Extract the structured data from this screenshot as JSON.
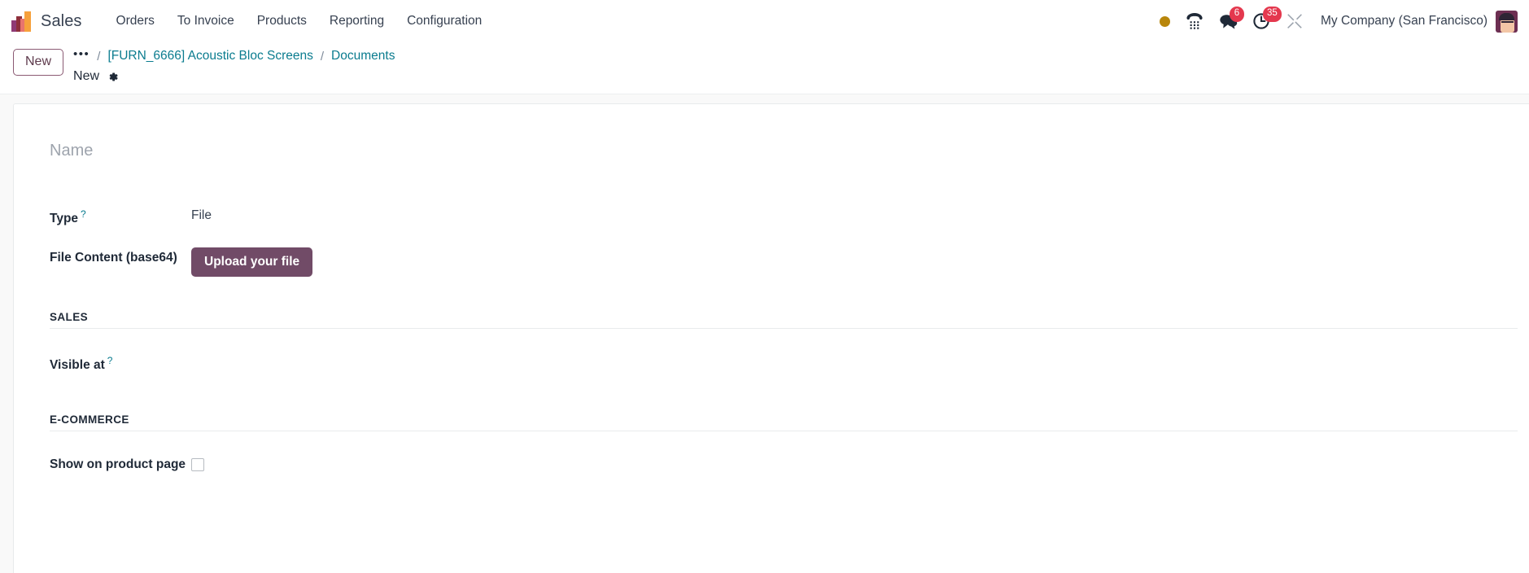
{
  "navbar": {
    "brand": "Sales",
    "logo_icon": "sales-bar-chart-logo",
    "menu": [
      {
        "label": "Orders"
      },
      {
        "label": "To Invoice"
      },
      {
        "label": "Products"
      },
      {
        "label": "Reporting"
      },
      {
        "label": "Configuration"
      }
    ],
    "systray": [
      {
        "icon": "amber-status-dot",
        "badge": ""
      },
      {
        "icon": "voip-phone-icon",
        "badge": ""
      },
      {
        "icon": "messages-chat-icon",
        "badge": "6"
      },
      {
        "icon": "activities-clock-icon",
        "badge": "35"
      },
      {
        "icon": "debug-tools-icon",
        "badge": ""
      }
    ],
    "company": "My Company (San Francisco)",
    "avatar_icon": "user-avatar"
  },
  "control_panel": {
    "new_button": "New",
    "breadcrumb_overflow_icon": "ellipsis-icon",
    "breadcrumb": [
      {
        "label": "[FURN_6666] Acoustic Bloc Screens"
      },
      {
        "label": "Documents"
      }
    ],
    "separator": "/",
    "record_title": "New",
    "settings_icon": "gear-icon",
    "save_icon": "cloud-upload-save-icon",
    "discard_icon": "undo-discard-icon",
    "chatter_icon": "bookmark-chatter-icon"
  },
  "form": {
    "name_placeholder": "Name",
    "fields": [
      {
        "label": "Type",
        "tooltip": "?",
        "value": "File"
      },
      {
        "label": "File Content (base64)",
        "tooltip": "",
        "button": "Upload your file"
      }
    ],
    "sections": [
      {
        "title": "SALES",
        "fields": [
          {
            "label": "Visible at",
            "tooltip": "?",
            "value": ""
          }
        ]
      },
      {
        "title": "E-COMMERCE",
        "fields": [
          {
            "label": "Show on product page",
            "tooltip": "",
            "checkbox": false
          }
        ]
      }
    ]
  },
  "colors": {
    "accent_purple": "#714b67",
    "link_teal": "#0b7c8f",
    "badge_red": "#e4384e",
    "status_amber": "#b8860b"
  }
}
